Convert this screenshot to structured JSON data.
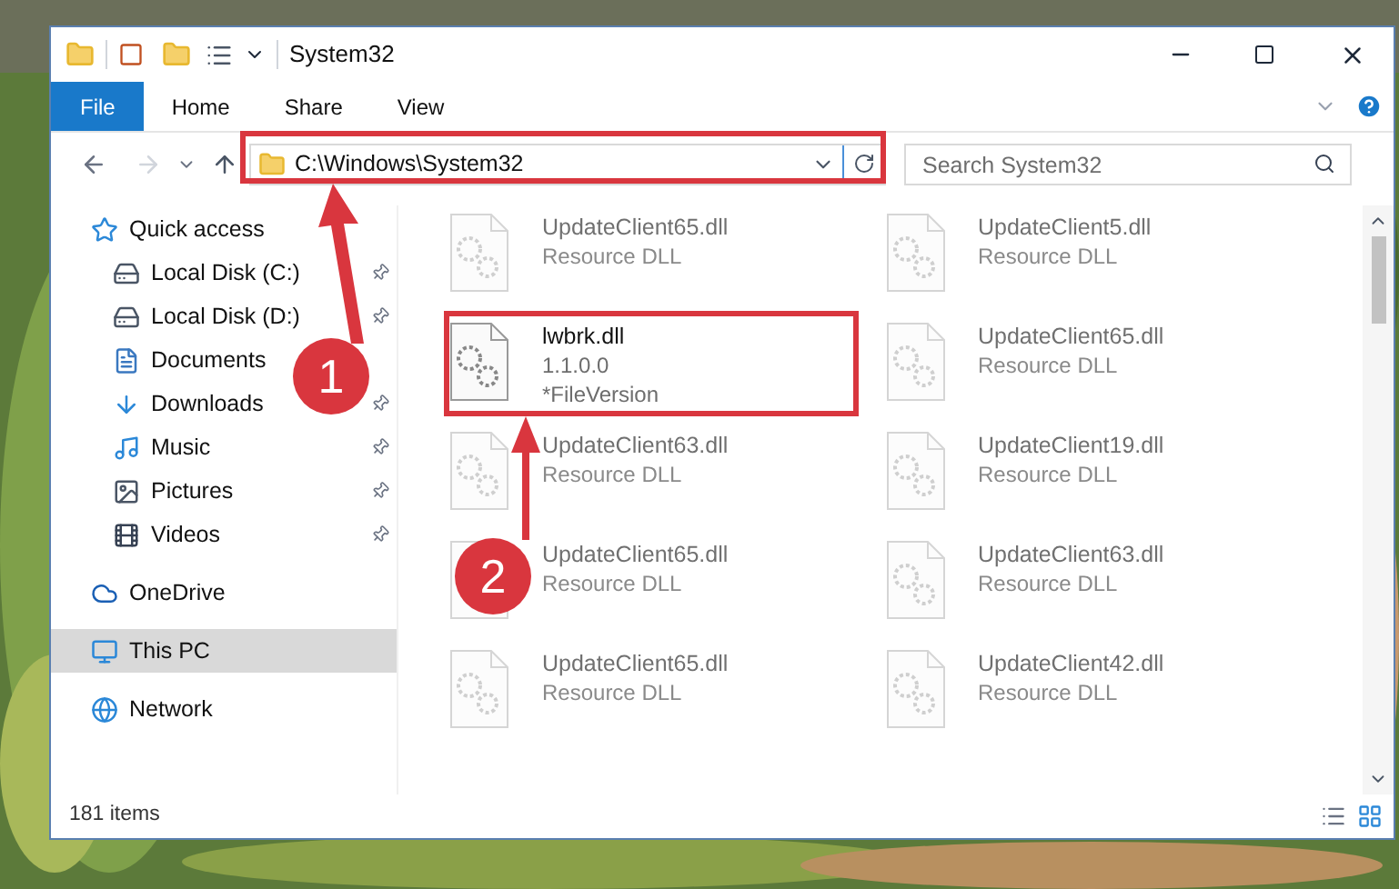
{
  "window": {
    "title": "System32"
  },
  "ribbon_tabs": [
    {
      "label": "File",
      "selected": true
    },
    {
      "label": "Home",
      "selected": false
    },
    {
      "label": "Share",
      "selected": false
    },
    {
      "label": "View",
      "selected": false
    }
  ],
  "address": {
    "value": "C:\\Windows\\System32"
  },
  "search": {
    "placeholder": "Search System32"
  },
  "sidebar": {
    "items": [
      {
        "label": "Quick access",
        "kind": "star",
        "selected": false,
        "children": [
          {
            "label": "Local Disk (C:)",
            "kind": "drive",
            "pinned": true,
            "selected": false
          },
          {
            "label": "Local Disk (D:)",
            "kind": "drive",
            "pinned": true,
            "selected": false
          },
          {
            "label": "Documents",
            "kind": "document",
            "pinned": false,
            "selected": false
          },
          {
            "label": "Downloads",
            "kind": "download",
            "pinned": true,
            "selected": false
          },
          {
            "label": "Music",
            "kind": "music",
            "pinned": true,
            "selected": false
          },
          {
            "label": "Pictures",
            "kind": "picture",
            "pinned": true,
            "selected": false
          },
          {
            "label": "Videos",
            "kind": "video",
            "pinned": true,
            "selected": false
          }
        ]
      },
      {
        "label": "OneDrive",
        "kind": "cloud",
        "selected": false
      },
      {
        "label": "This PC",
        "kind": "computer",
        "selected": true
      },
      {
        "label": "Network",
        "kind": "network",
        "selected": false
      }
    ]
  },
  "files": [
    {
      "name": "UpdateClient65.dll",
      "lines": [
        "Resource DLL"
      ],
      "faded": true
    },
    {
      "name": "UpdateClient5.dll",
      "lines": [
        "Resource DLL"
      ],
      "faded": true
    },
    {
      "name": "lwbrk.dll",
      "lines": [
        "1.1.0.0",
        "*FileVersion"
      ],
      "faded": false
    },
    {
      "name": "UpdateClient65.dll",
      "lines": [
        "Resource DLL"
      ],
      "faded": true
    },
    {
      "name": "UpdateClient63.dll",
      "lines": [
        "Resource DLL"
      ],
      "faded": true
    },
    {
      "name": "UpdateClient19.dll",
      "lines": [
        "Resource DLL"
      ],
      "faded": true
    },
    {
      "name": "UpdateClient65.dll",
      "lines": [
        "Resource DLL"
      ],
      "faded": true
    },
    {
      "name": "UpdateClient63.dll",
      "lines": [
        "Resource DLL"
      ],
      "faded": true
    },
    {
      "name": "UpdateClient65.dll",
      "lines": [
        "Resource DLL"
      ],
      "faded": true
    },
    {
      "name": "UpdateClient42.dll",
      "lines": [
        "Resource DLL"
      ],
      "faded": true
    }
  ],
  "status_bar": {
    "count": "181 items"
  },
  "annotations": [
    {
      "label": "1"
    },
    {
      "label": "2"
    }
  ]
}
